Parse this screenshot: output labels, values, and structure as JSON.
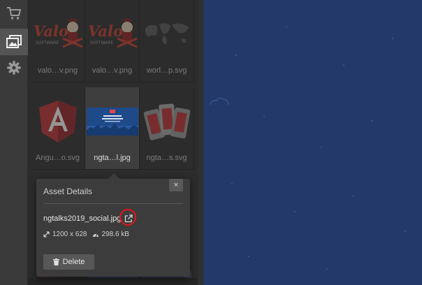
{
  "sidebar": {
    "items": [
      {
        "icon": "cart-icon",
        "active": false
      },
      {
        "icon": "gallery-icon",
        "active": true
      },
      {
        "icon": "gear-icon",
        "active": false
      }
    ]
  },
  "assets": [
    {
      "caption": "valo…v.png",
      "thumb": "valor-logo",
      "logo_text": "Valor",
      "logo_sub": "SOFTWARE"
    },
    {
      "caption": "valo…v.png",
      "thumb": "valor-logo",
      "logo_text": "Valor",
      "logo_sub": "SOFTWARE"
    },
    {
      "caption": "worl…p.svg",
      "thumb": "world-map"
    },
    {
      "caption": "Angu…o.svg",
      "thumb": "angular-logo"
    },
    {
      "caption": "ngta…l.jpg",
      "thumb": "ngtalks-banner",
      "selected": true
    },
    {
      "caption": "ngta…s.svg",
      "thumb": "tickets-graphic"
    }
  ],
  "asset_details": {
    "title": "Asset Details",
    "close_label": "×",
    "filename": "ngtalks2019_social.jpg",
    "dimensions": "1200 x 628",
    "size": "298.6 kB",
    "delete_label": "Delete"
  },
  "colors": {
    "canvas": "#23396a",
    "panel": "#2c2c2c",
    "highlight_ring": "#e8141a",
    "angular_red": "#b52e31"
  }
}
